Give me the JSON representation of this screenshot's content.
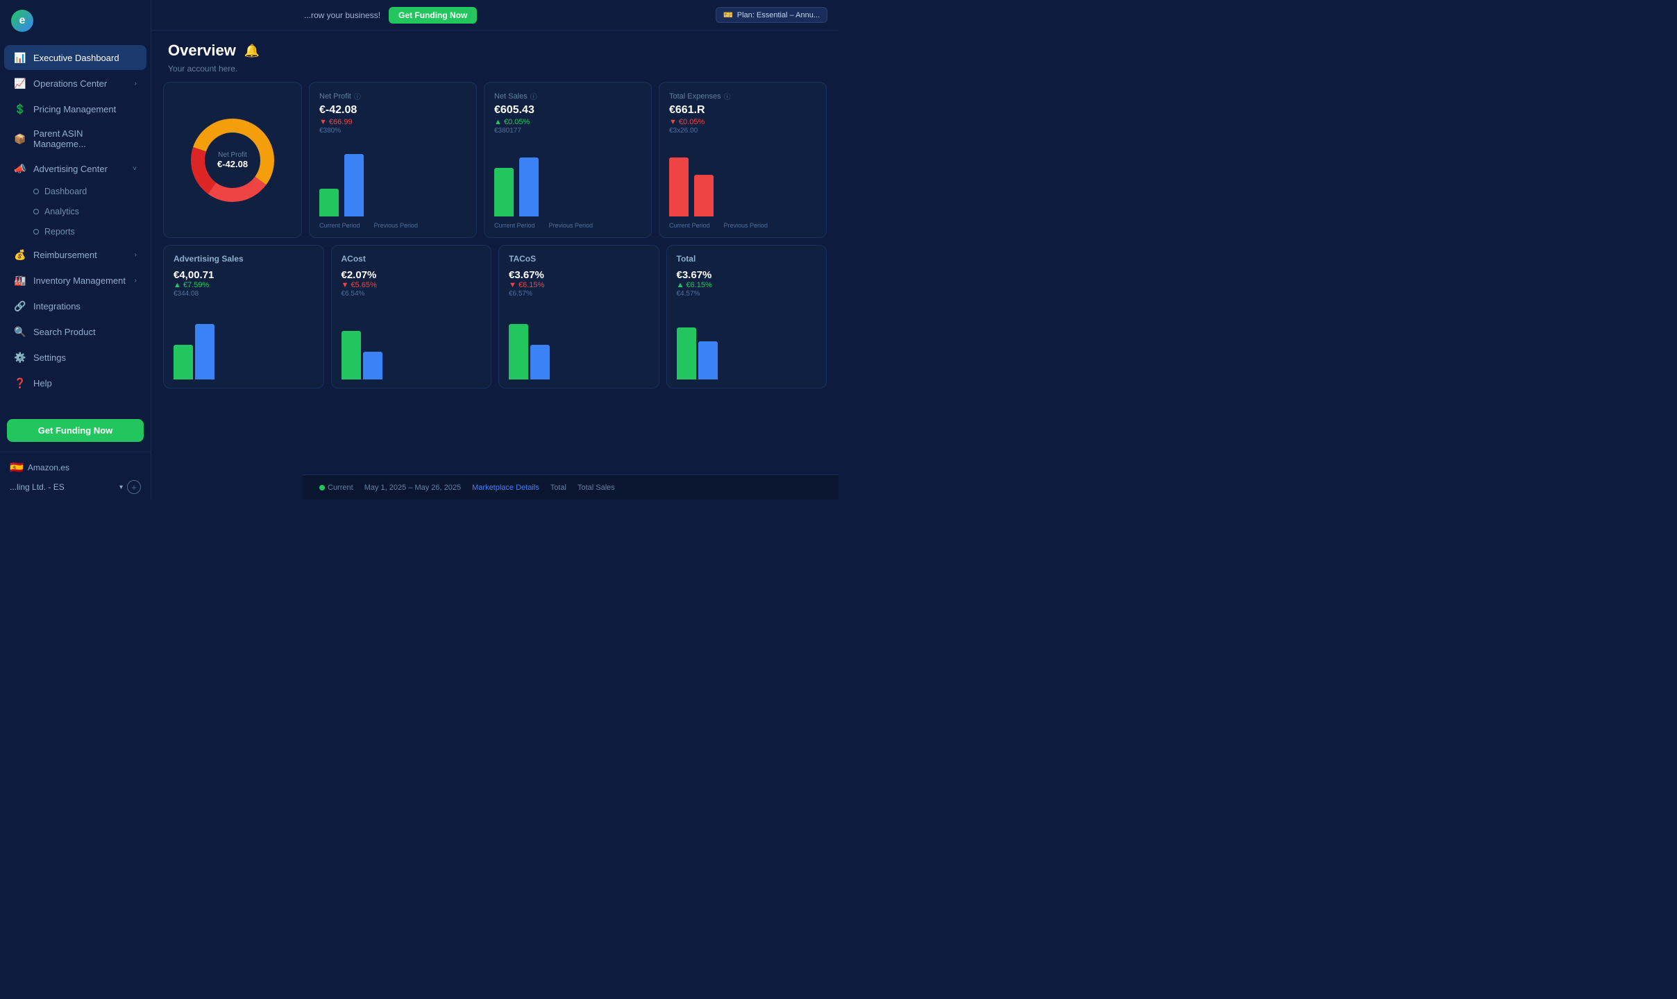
{
  "topbar": {
    "promo_text": "...row your business!",
    "promo_btn": "Get Funding Now",
    "plan_label": "Plan: Essential – Annu..."
  },
  "sidebar": {
    "logo_text": "e",
    "items": [
      {
        "id": "executive-dashboard",
        "label": "Executive Dashboard",
        "icon": "📊",
        "active": true,
        "has_arrow": false
      },
      {
        "id": "operations-center",
        "label": "Operations Center",
        "icon": "📈",
        "active": false,
        "has_arrow": true
      },
      {
        "id": "pricing-management",
        "label": "Pricing Management",
        "icon": "💲",
        "active": false,
        "has_arrow": false
      },
      {
        "id": "parent-asin",
        "label": "Parent ASIN Manageme...",
        "icon": "📦",
        "active": false,
        "has_arrow": false
      },
      {
        "id": "advertising-center",
        "label": "Advertising Center",
        "icon": "📣",
        "active": false,
        "has_arrow": true,
        "expanded": true
      }
    ],
    "sub_items": [
      {
        "id": "dashboard",
        "label": "Dashboard",
        "active": false
      },
      {
        "id": "analytics",
        "label": "Analytics",
        "active": false
      },
      {
        "id": "reports",
        "label": "Reports",
        "active": false
      }
    ],
    "bottom_items": [
      {
        "id": "reimbursement",
        "label": "Reimbursement",
        "icon": "💰",
        "has_arrow": true
      },
      {
        "id": "inventory-management",
        "label": "Inventory Management",
        "icon": "🏭",
        "has_arrow": true
      },
      {
        "id": "integrations",
        "label": "Integrations",
        "icon": "🔗",
        "has_arrow": false
      },
      {
        "id": "search-product",
        "label": "Search Product",
        "icon": "🔍",
        "has_arrow": false
      },
      {
        "id": "settings",
        "label": "Settings",
        "icon": "⚙️",
        "has_arrow": false
      },
      {
        "id": "help",
        "label": "Help",
        "icon": "❓",
        "has_arrow": false
      }
    ],
    "footer_btn": "Get Funding Now",
    "store_name": "Amazon.es",
    "store_sub": "...ling Ltd. - ES"
  },
  "page": {
    "title": "Overview",
    "subtitle": "Your account here.",
    "bell": "🔔"
  },
  "metrics": [
    {
      "title": "Net Profit",
      "value": "€-42.08",
      "change": "▼ €66.99",
      "change_type": "red",
      "prev": "€380%",
      "bar_current": 40,
      "bar_prev": 90,
      "bar_color_current": "green",
      "bar_color_prev": "blue",
      "period_current": "Current Period",
      "period_prev": "Previous Period"
    },
    {
      "title": "Net Sales",
      "value": "€605.43",
      "change": "▲ €0.05%",
      "change_type": "green",
      "prev": "€380177",
      "bar_current": 70,
      "bar_prev": 85,
      "bar_color_current": "green",
      "bar_color_prev": "blue",
      "period_current": "Current Period",
      "period_prev": "Previous Period"
    },
    {
      "title": "Total Expenses",
      "value": "€661.R",
      "change": "▼ €0.05%",
      "change_type": "red",
      "prev": "€3x26.00",
      "bar_current": 85,
      "bar_prev": 60,
      "bar_color_current": "red",
      "bar_color_prev": "red",
      "period_current": "Current Period",
      "period_prev": "Previous Period"
    }
  ],
  "ad_metrics": [
    {
      "title": "Advertising Sales",
      "value": "€4,00.71",
      "change": "▲ €7.59%",
      "change_type": "green",
      "prev": "€344.08",
      "bar_current": 50,
      "bar_prev": 80,
      "bar_color_current": "green",
      "bar_color_prev": "blue"
    },
    {
      "title": "ACost",
      "value": "€2.07%",
      "change": "▼ €5.65%",
      "change_type": "red",
      "prev": "€6.54%",
      "bar_current": 70,
      "bar_prev": 40,
      "bar_color_current": "green",
      "bar_color_prev": "blue"
    },
    {
      "title": "TACoS",
      "value": "€3.67%",
      "change": "▼ €6.15%",
      "change_type": "red",
      "prev": "€6.57%",
      "bar_current": 80,
      "bar_prev": 50,
      "bar_color_current": "green",
      "bar_color_prev": "blue"
    }
  ],
  "donut": {
    "title": "Net Profit",
    "value": "€-42.08",
    "segments": [
      {
        "color": "#f59e0b",
        "pct": 35
      },
      {
        "color": "#ef4444",
        "pct": 25
      },
      {
        "color": "#dc2626",
        "pct": 20
      },
      {
        "color": "#f59e0b",
        "pct": 20
      }
    ]
  },
  "bottom_bar": {
    "filter_current": "Current",
    "date_range": "May 1, 2025 – May 26, 2025",
    "marketplace_label": "Marketplace Details",
    "total_label": "Total",
    "total_sales_label": "Total Sales"
  }
}
